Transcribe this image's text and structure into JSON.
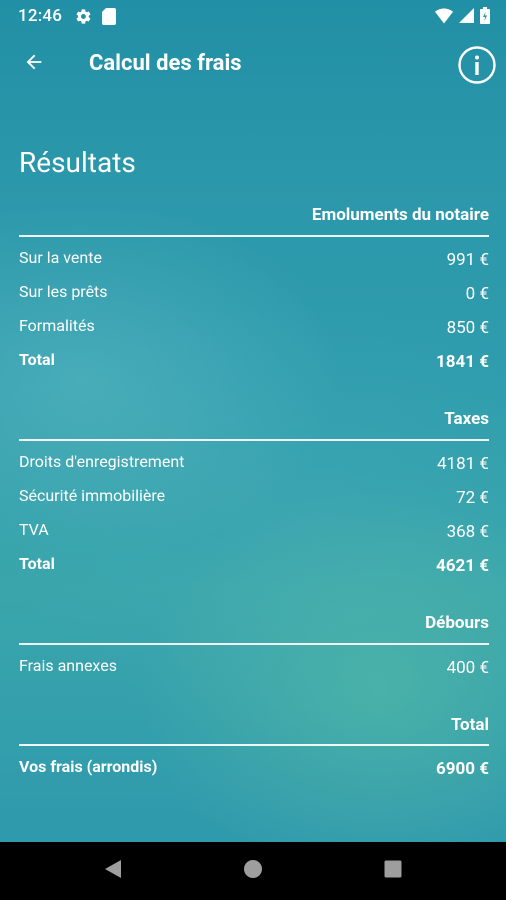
{
  "status_bar": {
    "time": "12:46",
    "left_icons": [
      "gear-icon",
      "sd-card-icon"
    ],
    "right_icons": [
      "wifi-icon",
      "cell-signal-icon",
      "battery-icon"
    ]
  },
  "app_bar": {
    "title": "Calcul des frais",
    "back_icon": "arrow-left-icon",
    "info_icon": "info-icon"
  },
  "results": {
    "title": "Résultats",
    "sections": [
      {
        "header": "Emoluments du notaire",
        "rows": [
          {
            "label": "Sur la vente",
            "value": "991 €"
          },
          {
            "label": "Sur les prêts",
            "value": "0 €"
          },
          {
            "label": "Formalités",
            "value": "850 €"
          },
          {
            "label": "Total",
            "value": "1841 €"
          }
        ]
      },
      {
        "header": "Taxes",
        "rows": [
          {
            "label": "Droits d'enregistrement",
            "value": "4181 €"
          },
          {
            "label": "Sécurité immobilière",
            "value": "72 €"
          },
          {
            "label": "TVA",
            "value": "368 €"
          },
          {
            "label": "Total",
            "value": "4621 €"
          }
        ]
      },
      {
        "header": "Débours",
        "rows": [
          {
            "label": "Frais annexes",
            "value": "400 €"
          }
        ]
      },
      {
        "header": "Total",
        "rows": [
          {
            "label": "Vos frais (arrondis)",
            "value": "6900 €"
          }
        ]
      }
    ]
  },
  "nav_bar": {
    "buttons": [
      "back-triangle-icon",
      "home-circle-icon",
      "recents-square-icon"
    ]
  },
  "colors": {
    "background_top": "#218fa5",
    "background_bottom": "#2f99ad",
    "text": "#ffffff",
    "nav_bar": "#000000"
  }
}
